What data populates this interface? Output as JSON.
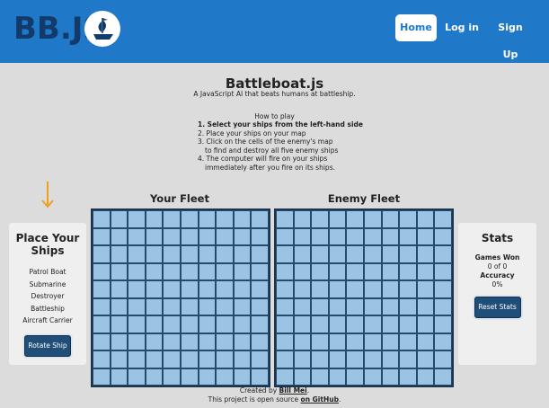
{
  "header": {
    "logo_text": "BB.JS",
    "nav": {
      "home": "Home",
      "login": "Log in",
      "signup": "Sign Up"
    }
  },
  "main": {
    "title": "Battleboat.js",
    "subtitle": "A JavaScript AI that beats humans at battleship.",
    "howto_title": "How to play",
    "steps": [
      "1. Select your ships from the left-hand side",
      "2. Place your ships on your map",
      "3. Click on the cells of the enemy's map",
      "to find and destroy all five enemy ships",
      "4. The computer will fire on your ships",
      "immediately after you fire on its ships."
    ]
  },
  "place_ships": {
    "title_line1": "Place Your",
    "title_line2": "Ships",
    "ships": [
      "Patrol Boat",
      "Submarine",
      "Destroyer",
      "Battleship",
      "Aircraft Carrier"
    ],
    "rotate_label": "Rotate Ship"
  },
  "fleets": {
    "your_fleet": "Your Fleet",
    "enemy_fleet": "Enemy Fleet"
  },
  "stats": {
    "title": "Stats",
    "games_won_label": "Games Won",
    "games_won_value": "0 of 0",
    "accuracy_label": "Accuracy",
    "accuracy_value": "0%",
    "reset_label": "Reset Stats"
  },
  "footer": {
    "created_by": "Created by ",
    "author": "Bill Mei",
    "period1": ".",
    "open_source": "This project is open source ",
    "github": "on GitHub",
    "period2": "."
  },
  "colors": {
    "header": "#1f78c8",
    "logo": "#123a6b",
    "grid_fill": "#9bc4e4",
    "grid_border": "#1b3550",
    "button": "#1f4e78",
    "arrow": "#f0a020"
  }
}
